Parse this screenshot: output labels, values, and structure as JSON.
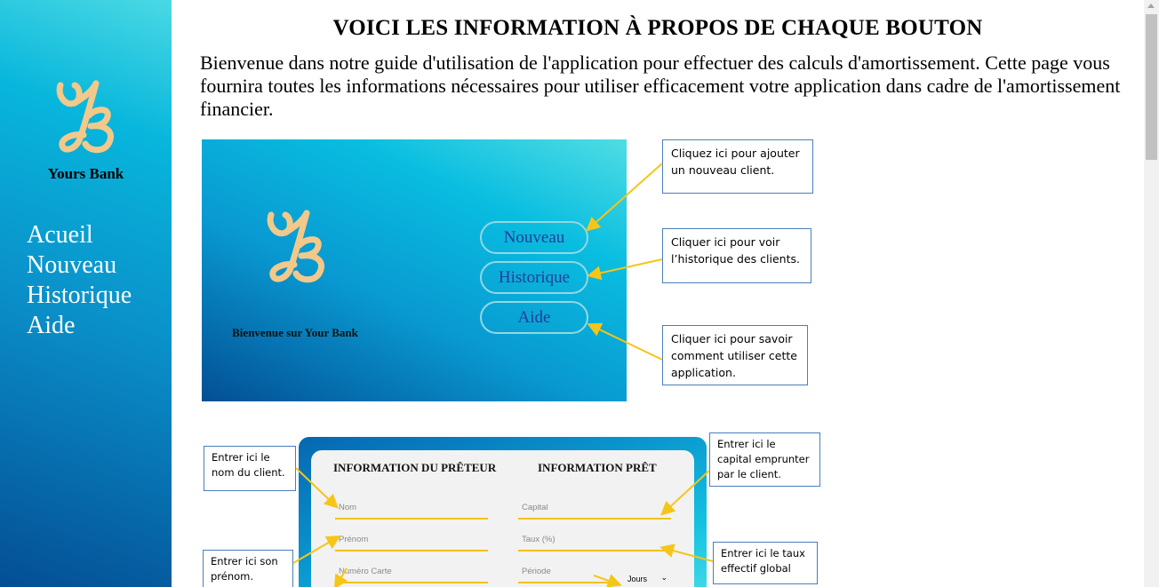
{
  "sidebar": {
    "logo_icon": "yb-monogram-logo",
    "brand": "Yours Bank",
    "nav": [
      "Acueil",
      "Nouveau",
      "Historique",
      "Aide"
    ]
  },
  "main": {
    "title": "VOICI LES INFORMATION À PROPOS DE CHAQUE BOUTON",
    "intro": "Bienvenue dans notre guide d'utilisation de l'application pour effectuer des calculs d'amortissement. Cette page vous fournira toutes les informations nécessaires pour utiliser efficacement votre application dans cadre de l'amortissement financier."
  },
  "screenshot1": {
    "welcome": "Bienvenue sur Your Bank",
    "buttons": [
      "Nouveau",
      "Historique",
      "Aide"
    ],
    "callouts": [
      "Cliquez ici pour ajouter un nouveau client.",
      "Cliquer ici pour voir l’historique des clients.",
      "Cliquer ici pour savoir comment utiliser cette application."
    ]
  },
  "screenshot2": {
    "left_heading": "INFORMATION DU PRÊTEUR",
    "right_heading": "INFORMATION PRÊT",
    "left_fields": [
      "Nom",
      "Prénom",
      "Numéro Carte"
    ],
    "right_fields": [
      "Capital",
      "Taux (%)",
      "Période"
    ],
    "period_select": "Jours",
    "callouts": {
      "nom": "Entrer ici le nom du client.",
      "prenom": "Entrer ici son prénom.",
      "capital": "Entrer ici le capital emprunter par le client.",
      "taux": "Entrer ici le taux effectif global"
    }
  },
  "colors": {
    "logo_gold": "#f2c98a",
    "arrow_yellow": "#f5c518",
    "callout_border": "#4a7ebb",
    "button_text": "#283c96"
  }
}
